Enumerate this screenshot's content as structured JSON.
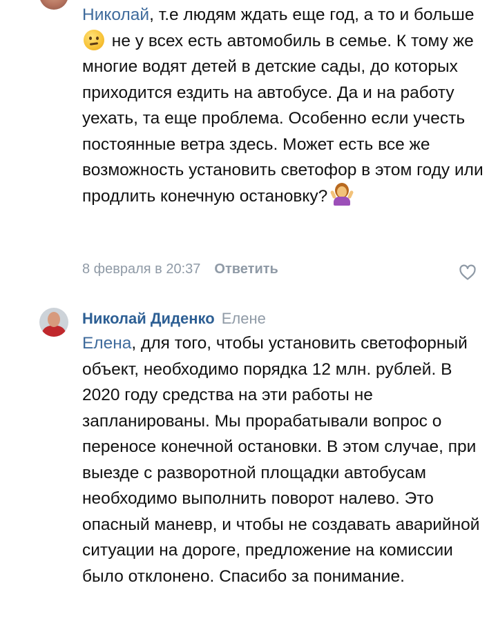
{
  "comment_prev": {
    "mention": "Николай",
    "text_before_emoji": ", т.е людям ждать еще год, а то и больше",
    "emoji_1": "confused-face-emoji",
    "text_after_emoji": " не у всех есть автомобиль в семье. К тому же многие водят детей в детские сады, до которых приходится ездить на автобусе. Да и на работу уехать, та еще проблема. Особенно если учесть постоянные ветра здесь. Может есть все же возможность установить светофор в этом году или продлить конечную остановку?",
    "emoji_2": "person-shrugging-emoji",
    "date": "8 февраля в 20:37",
    "reply_label": "Ответить",
    "like_icon": "heart-outline-icon"
  },
  "comment_reply": {
    "author": "Николай Диденко",
    "reply_to": "Елене",
    "mention": "Елена",
    "text": ", для того, чтобы установить светофорный объект, необходимо порядка 12 млн. рублей. В 2020 году средства на эти работы не запланированы. Мы прорабатывали вопрос о переносе конечной остановки. В этом случае, при выезде с разворотной площадки автобусам необходимо выполнить поворот налево. Это опасный маневр, и чтобы не создавать аварийной ситуации на дороге, предложение на комиссии было отклонено. Спасибо за понимание."
  },
  "colors": {
    "mention": "#3f6b9c",
    "author": "#2d5f94",
    "meta": "#8f9aa6",
    "text": "#111111"
  }
}
